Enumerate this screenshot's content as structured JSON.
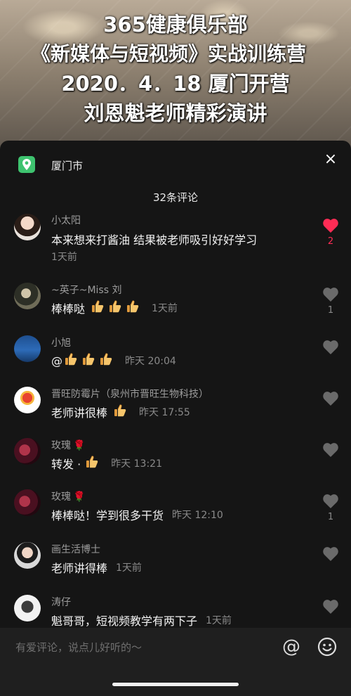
{
  "video": {
    "title_lines": [
      "365健康俱乐部",
      "《新媒体与短视频》实战训练营",
      "2020．4．18 厦门开营",
      "刘恩魁老师精彩演讲"
    ]
  },
  "sheet": {
    "location": "厦门市",
    "close_glyph": "×",
    "comment_count": "32条评论"
  },
  "comments": [
    {
      "name": "小太阳",
      "text": "本来想来打酱油 结果被老师吸引好好学习",
      "thumbs": 0,
      "time": "1天前",
      "likes": "2",
      "liked": true
    },
    {
      "name": "~英子~Miss 刘",
      "text": "棒棒哒",
      "thumbs": 3,
      "time": "1天前",
      "likes": "1",
      "liked": false
    },
    {
      "name": "小旭",
      "text": "@",
      "thumbs": 3,
      "time": "昨天 20:04",
      "likes": "",
      "liked": false
    },
    {
      "name": "晋旺防霉片（泉州市晋旺生物科技）",
      "text": "老师讲很棒",
      "thumbs": 1,
      "time": "昨天 17:55",
      "likes": "",
      "liked": false
    },
    {
      "name": "玫瑰",
      "text": "转发 ·",
      "thumbs": 1,
      "time": "昨天 13:21",
      "likes": "",
      "liked": false,
      "rose": "🌹"
    },
    {
      "name": "玫瑰",
      "text": "棒棒哒！学到很多干货",
      "thumbs": 0,
      "time": "昨天 12:10",
      "likes": "1",
      "liked": false,
      "rose": "🌹"
    },
    {
      "name": "画生活博士",
      "text": "老师讲得棒",
      "thumbs": 0,
      "time": "1天前",
      "likes": "",
      "liked": false
    },
    {
      "name": "涛仔",
      "text": "魁哥哥，短视频教学有两下子",
      "thumbs": 0,
      "time": "1天前",
      "likes": "",
      "liked": false
    }
  ],
  "input": {
    "placeholder": "有爱评论，说点儿好听的～",
    "at_glyph": "@"
  },
  "colors": {
    "accent_red": "#fe2c55",
    "location_green": "#3ec36f",
    "sheet_bg": "#151515"
  },
  "icons": {
    "like": "heart-icon",
    "location": "location-pin-icon",
    "close": "close-icon",
    "emoji": "emoji-icon",
    "thumb": "thumbs-up-icon",
    "rose": "rose-icon"
  }
}
